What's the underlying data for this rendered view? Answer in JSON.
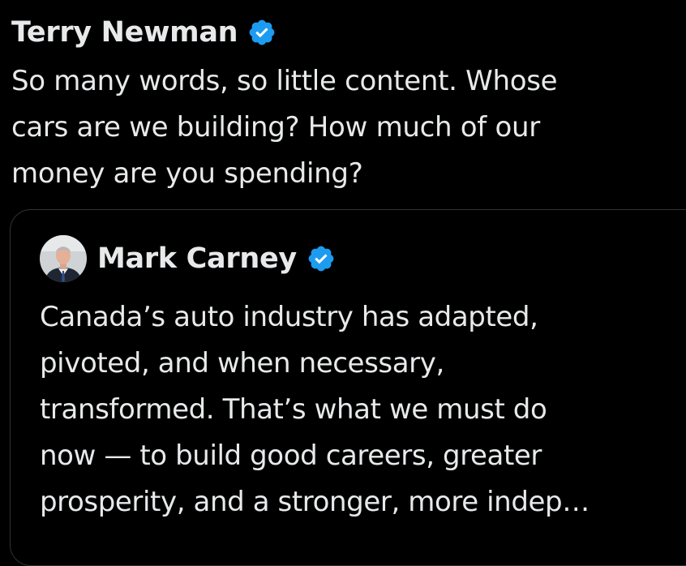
{
  "post": {
    "author": {
      "name": "Terry Newman",
      "verified_icon": "verified-badge-icon"
    },
    "text_lines": [
      "So many words, so little content. Whose",
      "cars are we building? How much of our",
      "money are you spending?"
    ]
  },
  "quoted_post": {
    "author": {
      "name": "Mark Carney",
      "avatar_icon": "avatar-photo",
      "verified_icon": "verified-badge-icon"
    },
    "text_lines": [
      "Canada’s auto industry has adapted,",
      "pivoted, and when necessary,",
      "transformed. That’s what we must do",
      "now — to build good careers, greater",
      "prosperity, and a stronger, more indep…"
    ]
  },
  "colors": {
    "background": "#000000",
    "text": "#e7e9ea",
    "verified_blue": "#1d9bf0",
    "card_border": "#2f3336"
  }
}
